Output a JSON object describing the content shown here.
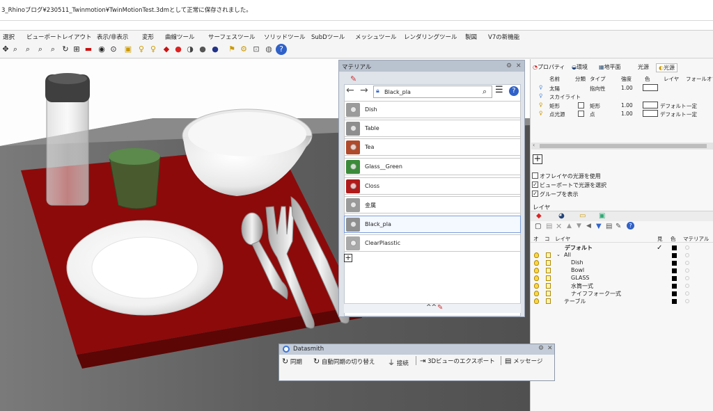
{
  "command_line": {
    "text": "3_Rhinoブログ¥230511_Twinmotion¥TwinMotionTest.3dmとして正常に保存されました。"
  },
  "menu": [
    "選択",
    "ビューポートレイアウト",
    "表示/非表示",
    "変形",
    "曲線ツール",
    "サーフェスツール",
    "ソリッドツール",
    "SubDツール",
    "メッシュツール",
    "レンダリングツール",
    "製図",
    "V7の新機能"
  ],
  "toolbar_icons": [
    "pan-icon",
    "zoom-icon",
    "zoom-window-icon",
    "zoom-extents-icon",
    "zoom-selected-icon",
    "rotate-view-icon",
    "viewport-layout-icon",
    "car-icon",
    "eye-icon",
    "named-view-icon",
    "camera-icon",
    "light-icon",
    "render-light-icon",
    "render-icon",
    "material-icon",
    "environment-icon",
    "ground-plane-icon",
    "sun-icon",
    "texture-icon",
    "options-icon",
    "layer-icon",
    "help-icon"
  ],
  "material_panel": {
    "title": "マテリアル",
    "search_value": "Black_pla",
    "materials": [
      {
        "name": "Dish",
        "color": "#9b9b9b"
      },
      {
        "name": "Table",
        "color": "#8e8e8e"
      },
      {
        "name": "Tea",
        "color": "#b04a2a"
      },
      {
        "name": "Glass__Green",
        "color": "#3a8a3a"
      },
      {
        "name": "Closs",
        "color": "#b11a1a"
      },
      {
        "name": "金属",
        "color": "#9a9a9a"
      },
      {
        "name": "Black_pla",
        "color": "#8f8f8f"
      },
      {
        "name": "ClearPlasstic",
        "color": "#a9a9a9"
      }
    ],
    "selected": "Black_pla",
    "footer_glyph": "^^"
  },
  "properties": {
    "tabs": [
      "プロパティ",
      "環境",
      "地平面",
      "光源",
      "光源"
    ],
    "columns": [
      "名前",
      "分類",
      "タイプ",
      "強度",
      "色",
      "レイヤ",
      "フォールオフ"
    ],
    "lights": [
      {
        "name": "太陽",
        "type": "指向性",
        "strength": "1.00",
        "layer": "",
        "falloff": ""
      },
      {
        "name": "スカイライト",
        "type": "",
        "strength": "",
        "layer": "",
        "falloff": ""
      },
      {
        "name": "矩形",
        "type": "矩形",
        "strength": "1.00",
        "layer": "デフォルト",
        "falloff": "一定"
      },
      {
        "name": "点光源",
        "type": "点",
        "strength": "1.00",
        "layer": "デフォルト",
        "falloff": "一定"
      }
    ],
    "options": [
      {
        "label": "オフレイヤの光源を使用",
        "checked": false
      },
      {
        "label": "ビューポートで光源を選択",
        "checked": true
      },
      {
        "label": "グループを表示",
        "checked": true
      }
    ]
  },
  "layers": {
    "title": "レイヤ",
    "columns": [
      "オ",
      "コ",
      "レイヤ",
      "見",
      "色",
      "マテリアル"
    ],
    "rows": [
      {
        "name": "デフォルト",
        "indent": 0,
        "current": true,
        "bold": true
      },
      {
        "name": "All",
        "indent": 0,
        "expanded": true
      },
      {
        "name": "Dish",
        "indent": 2
      },
      {
        "name": "Bowl",
        "indent": 2
      },
      {
        "name": "GLASS",
        "indent": 2
      },
      {
        "name": "水筒一式",
        "indent": 2
      },
      {
        "name": "ナイフフォーク一式",
        "indent": 2
      },
      {
        "name": "テーブル",
        "indent": 1
      }
    ],
    "check_mark": "✓"
  },
  "datasmith": {
    "title": "Datasmith",
    "buttons": [
      "同期",
      "自動同期の切り替え",
      "接続",
      "3Dビューのエクスポート",
      "メッセージ"
    ]
  },
  "colors": {
    "placemat": "#8c0a0a",
    "table": "#5a5a5a",
    "accent": "#3b6fd1"
  }
}
